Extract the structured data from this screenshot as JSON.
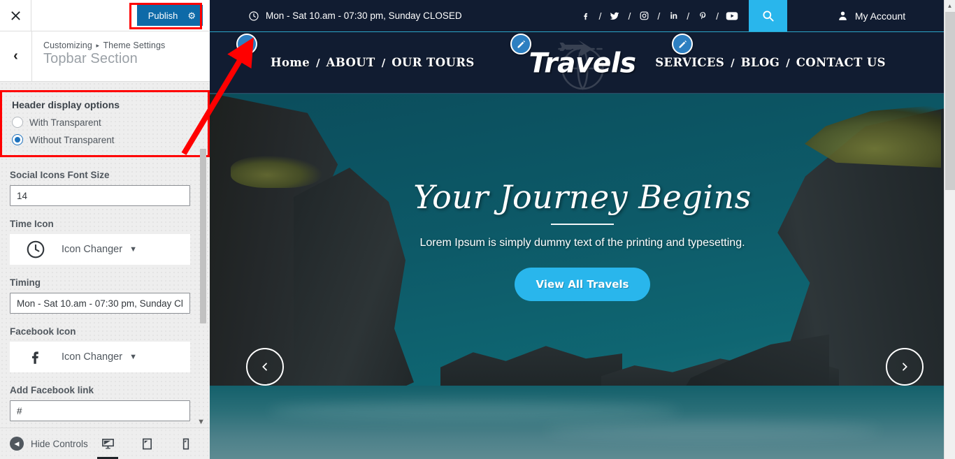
{
  "sidebar": {
    "close_icon": "close-icon",
    "publish_label": "Publish",
    "publish_gear_icon": "gear-icon",
    "back_icon": "chevron-left-icon",
    "breadcrumb_root": "Customizing",
    "breadcrumb_separator": "▸",
    "breadcrumb_parent": "Theme Settings",
    "panel_title": "Topbar Section",
    "header_display": {
      "title": "Header display options",
      "options": [
        {
          "label": "With Transparent",
          "selected": false
        },
        {
          "label": "Without Transparent",
          "selected": true
        }
      ]
    },
    "fields": [
      {
        "label": "Social Icons Font Size",
        "value": "14",
        "type": "text"
      },
      {
        "label": "Time Icon",
        "value": "Icon Changer",
        "type": "icon-changer",
        "icon": "clock-icon"
      },
      {
        "label": "Timing",
        "value": "Mon - Sat 10.am - 07:30 pm, Sunday Cl",
        "type": "text"
      },
      {
        "label": "Facebook Icon",
        "value": "Icon Changer",
        "type": "icon-changer",
        "icon": "facebook-icon"
      },
      {
        "label": "Add Facebook link",
        "value": "#",
        "type": "text"
      }
    ],
    "footer": {
      "hide_controls_label": "Hide Controls",
      "hide_controls_icon": "collapse-icon",
      "devices": [
        {
          "name": "desktop-icon",
          "active": true
        },
        {
          "name": "tablet-icon",
          "active": false
        },
        {
          "name": "mobile-icon",
          "active": false
        }
      ]
    },
    "highlight_color": "#ff0000",
    "publish_color": "#0d6aa8"
  },
  "preview": {
    "topbar": {
      "clock_icon": "clock-icon",
      "timing": "Mon - Sat 10.am - 07:30 pm, Sunday CLOSED",
      "social_separator": "/",
      "social": [
        "facebook-icon",
        "twitter-icon",
        "instagram-icon",
        "linkedin-icon",
        "pinterest-icon",
        "youtube-icon"
      ],
      "search_icon": "search-icon",
      "account_icon": "user-icon",
      "account_label": "My Account",
      "background": "#111c31",
      "search_background": "#29b6ec"
    },
    "nav": {
      "left": [
        "Home",
        "ABOUT",
        "OUR TOURS"
      ],
      "right": [
        "SERVICES",
        "BLOG",
        "CONTACT US"
      ],
      "separator": "/",
      "logo_text": "Travels",
      "logo_mark_icon": "globe-airplane-icon",
      "edit_icon": "pencil-icon"
    },
    "hero": {
      "title": "Your Journey Begins",
      "subtitle": "Lorem Ipsum is simply dummy text of the printing and typesetting.",
      "cta_label": "View All Travels",
      "cta_color": "#29b6ec",
      "prev_icon": "chevron-left-icon",
      "next_icon": "chevron-right-icon"
    }
  }
}
